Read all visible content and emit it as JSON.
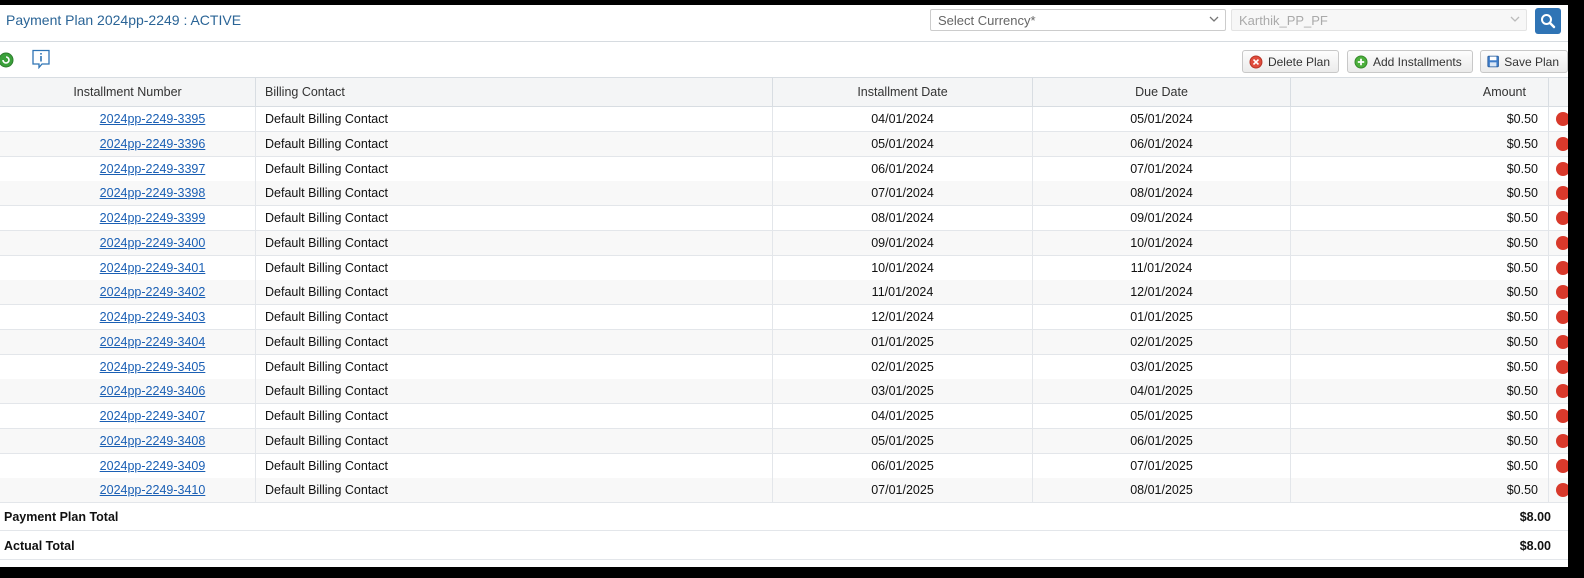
{
  "header": {
    "title": "Payment Plan 2024pp-2249 : ACTIVE",
    "currency_placeholder": "Select Currency*",
    "account_value": "Karthik_PP_PF"
  },
  "toolbar": {
    "delete_label": "Delete Plan",
    "add_label": "Add Installments",
    "save_label": "Save Plan"
  },
  "table": {
    "columns": [
      "Installment Number",
      "Billing Contact",
      "Installment Date",
      "Due Date",
      "Amount"
    ],
    "rows": [
      {
        "number": "2024pp-2249-3395",
        "contact": "Default Billing Contact",
        "installment_date": "04/01/2024",
        "due_date": "05/01/2024",
        "amount": "$0.50"
      },
      {
        "number": "2024pp-2249-3396",
        "contact": "Default Billing Contact",
        "installment_date": "05/01/2024",
        "due_date": "06/01/2024",
        "amount": "$0.50"
      },
      {
        "number": "2024pp-2249-3397",
        "contact": "Default Billing Contact",
        "installment_date": "06/01/2024",
        "due_date": "07/01/2024",
        "amount": "$0.50"
      },
      {
        "number": "2024pp-2249-3398",
        "contact": "Default Billing Contact",
        "installment_date": "07/01/2024",
        "due_date": "08/01/2024",
        "amount": "$0.50"
      },
      {
        "number": "2024pp-2249-3399",
        "contact": "Default Billing Contact",
        "installment_date": "08/01/2024",
        "due_date": "09/01/2024",
        "amount": "$0.50"
      },
      {
        "number": "2024pp-2249-3400",
        "contact": "Default Billing Contact",
        "installment_date": "09/01/2024",
        "due_date": "10/01/2024",
        "amount": "$0.50"
      },
      {
        "number": "2024pp-2249-3401",
        "contact": "Default Billing Contact",
        "installment_date": "10/01/2024",
        "due_date": "11/01/2024",
        "amount": "$0.50"
      },
      {
        "number": "2024pp-2249-3402",
        "contact": "Default Billing Contact",
        "installment_date": "11/01/2024",
        "due_date": "12/01/2024",
        "amount": "$0.50"
      },
      {
        "number": "2024pp-2249-3403",
        "contact": "Default Billing Contact",
        "installment_date": "12/01/2024",
        "due_date": "01/01/2025",
        "amount": "$0.50"
      },
      {
        "number": "2024pp-2249-3404",
        "contact": "Default Billing Contact",
        "installment_date": "01/01/2025",
        "due_date": "02/01/2025",
        "amount": "$0.50"
      },
      {
        "number": "2024pp-2249-3405",
        "contact": "Default Billing Contact",
        "installment_date": "02/01/2025",
        "due_date": "03/01/2025",
        "amount": "$0.50"
      },
      {
        "number": "2024pp-2249-3406",
        "contact": "Default Billing Contact",
        "installment_date": "03/01/2025",
        "due_date": "04/01/2025",
        "amount": "$0.50"
      },
      {
        "number": "2024pp-2249-3407",
        "contact": "Default Billing Contact",
        "installment_date": "04/01/2025",
        "due_date": "05/01/2025",
        "amount": "$0.50"
      },
      {
        "number": "2024pp-2249-3408",
        "contact": "Default Billing Contact",
        "installment_date": "05/01/2025",
        "due_date": "06/01/2025",
        "amount": "$0.50"
      },
      {
        "number": "2024pp-2249-3409",
        "contact": "Default Billing Contact",
        "installment_date": "06/01/2025",
        "due_date": "07/01/2025",
        "amount": "$0.50"
      },
      {
        "number": "2024pp-2249-3410",
        "contact": "Default Billing Contact",
        "installment_date": "07/01/2025",
        "due_date": "08/01/2025",
        "amount": "$0.50"
      }
    ]
  },
  "totals": {
    "plan_total_label": "Payment Plan Total",
    "plan_total_value": "$8.00",
    "actual_total_label": "Actual Total",
    "actual_total_value": "$8.00"
  },
  "colors": {
    "title": "#2a6496",
    "link": "#1a5fb4",
    "search_button": "#2f74b5",
    "delete_indicator": "#d8392b"
  },
  "icons": {
    "search": "search-icon",
    "refresh": "refresh-icon",
    "info": "info-icon",
    "delete": "delete-icon",
    "add": "add-icon",
    "save": "save-icon",
    "row_delete": "row-delete-icon"
  }
}
